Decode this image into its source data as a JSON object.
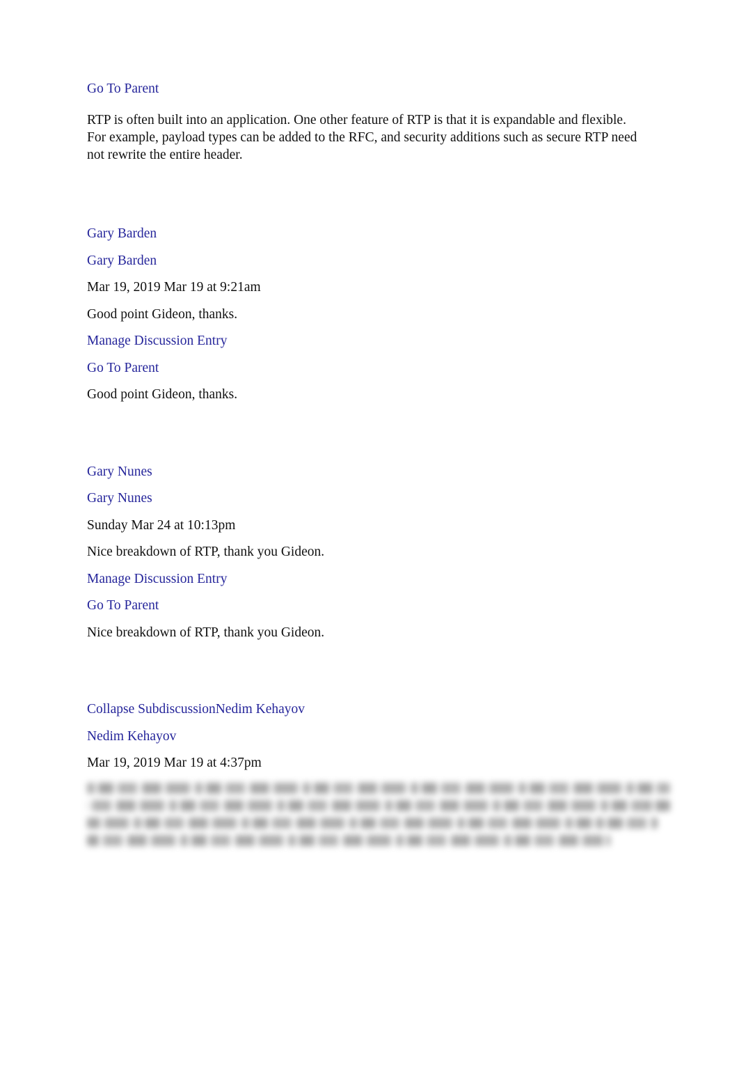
{
  "page": {
    "background_color": "#ffffff",
    "text_color": "#111111",
    "link_color": "#26269b"
  },
  "entries": [
    {
      "id": "entry-rtp-excerpt",
      "links": {
        "go_to_parent": "Go To Parent"
      },
      "body": "RTP is often built into an application. One other feature of RTP is that it is expandable and flexible. For example, payload types can be added to the RFC, and security additions such as secure RTP need not rewrite the entire header."
    },
    {
      "id": "entry-gary-barden",
      "author_link_top": "Gary Barden",
      "author_link": "Gary Barden",
      "timestamp": "Mar 19, 2019 Mar 19 at 9:21am",
      "preview": "Good point Gideon, thanks.",
      "links": {
        "manage_discussion_entry": "Manage Discussion Entry",
        "go_to_parent": "Go To Parent"
      },
      "body": "Good point Gideon, thanks."
    },
    {
      "id": "entry-gary-nunes",
      "author_link_top": "Gary Nunes",
      "author_link": "Gary Nunes",
      "timestamp": "Sunday Mar 24 at 10:13pm",
      "preview": "Nice breakdown of RTP, thank you Gideon.",
      "links": {
        "manage_discussion_entry": "Manage Discussion Entry",
        "go_to_parent": "Go To Parent"
      },
      "body": "Nice breakdown of RTP, thank you Gideon."
    },
    {
      "id": "entry-nedim-kehayov",
      "links": {
        "collapse_subdiscussion": "Collapse Subdiscussion"
      },
      "author_link_top": "Nedim Kehayov",
      "author_link": "Nedim Kehayov",
      "timestamp": "Mar 19, 2019 Mar 19 at 4:37pm",
      "body": "",
      "body_state": "blurred"
    }
  ]
}
